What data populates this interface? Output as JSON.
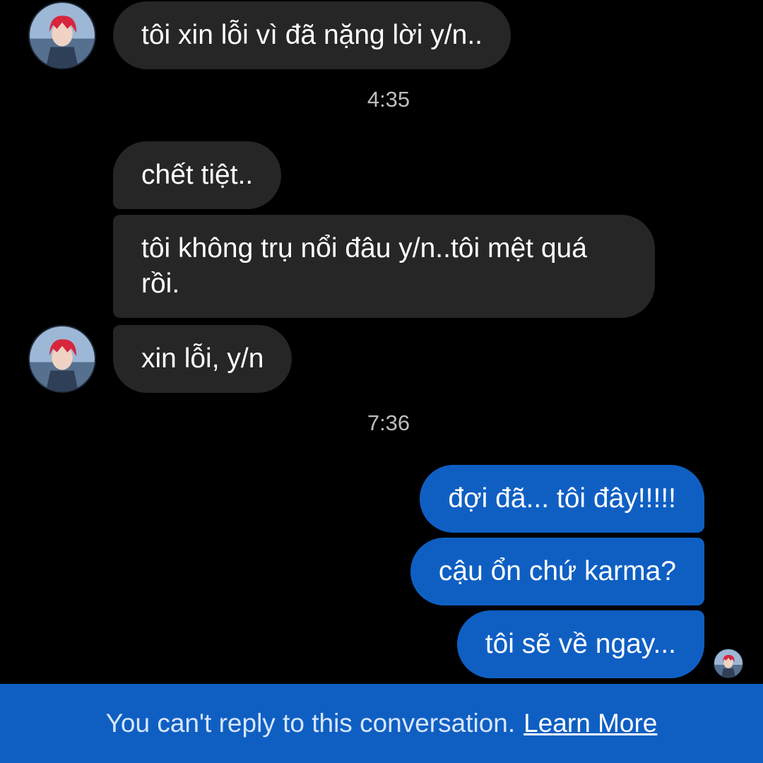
{
  "conversation": {
    "messages": [
      {
        "text": "tôi xin lỗi vì đã nặng lời y/n..",
        "direction": "incoming"
      },
      {
        "text": "chết tiệt..",
        "direction": "incoming"
      },
      {
        "text": "tôi không trụ nổi đâu y/n..tôi mệt quá rồi.",
        "direction": "incoming"
      },
      {
        "text": "xin lỗi, y/n",
        "direction": "incoming"
      },
      {
        "text": "đợi đã... tôi đây!!!!!",
        "direction": "outgoing"
      },
      {
        "text": "cậu ổn chứ karma?",
        "direction": "outgoing"
      },
      {
        "text": "tôi sẽ về ngay...",
        "direction": "outgoing"
      }
    ],
    "timestamps": [
      "4:35",
      "7:36"
    ]
  },
  "footer": {
    "notice": "You can't reply to this conversation.",
    "link_label": "Learn More"
  },
  "colors": {
    "incoming_bubble": "#262626",
    "outgoing_bubble": "#0f5fc3",
    "background": "#000000",
    "footer_bar": "#0f5fc3"
  },
  "icons": {
    "contact_avatar": "avatar-red-hair-character",
    "seen_avatar": "seen-receipt-avatar"
  }
}
